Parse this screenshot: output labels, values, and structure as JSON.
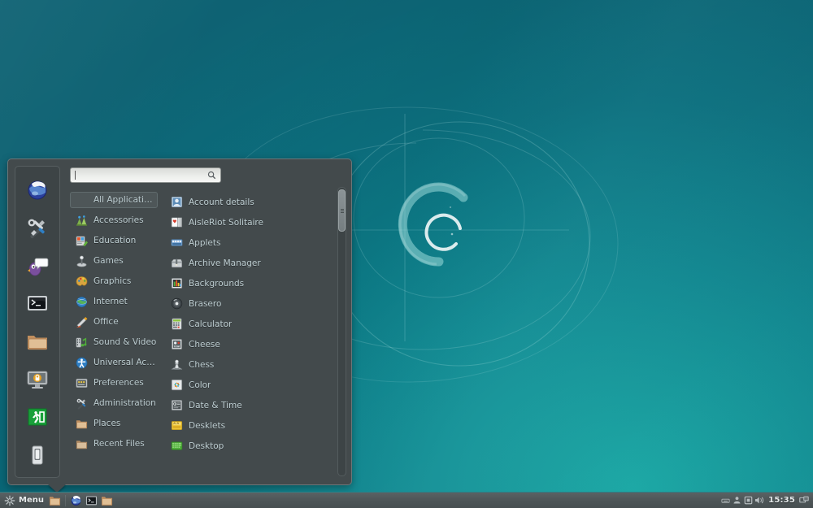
{
  "desktop": {
    "wallpaper_name": "debian-swirl-wallpaper",
    "bg_color_dark": "#095f70",
    "bg_color_light": "#16a7a4"
  },
  "menu": {
    "search": {
      "value": "",
      "placeholder": "",
      "icon": "search-icon"
    },
    "favorites": [
      {
        "name": "web-browser-icon",
        "label": "Web Browser"
      },
      {
        "name": "system-settings-icon",
        "label": "System Settings"
      },
      {
        "name": "chat-pidgin-icon",
        "label": "Pidgin Internet Messenger"
      },
      {
        "name": "terminal-icon",
        "label": "Terminal"
      },
      {
        "name": "file-manager-icon",
        "label": "Files"
      },
      {
        "name": "lock-screen-icon",
        "label": "Lock Screen"
      },
      {
        "name": "logout-icon",
        "label": "Log Out"
      },
      {
        "name": "shutdown-icon",
        "label": "Quit"
      }
    ],
    "categories": [
      {
        "label": "All Applications",
        "icon": "all-applications-icon",
        "selected": true
      },
      {
        "label": "Accessories",
        "icon": "accessories-icon",
        "selected": false
      },
      {
        "label": "Education",
        "icon": "education-icon",
        "selected": false
      },
      {
        "label": "Games",
        "icon": "games-icon",
        "selected": false
      },
      {
        "label": "Graphics",
        "icon": "graphics-icon",
        "selected": false
      },
      {
        "label": "Internet",
        "icon": "internet-icon",
        "selected": false
      },
      {
        "label": "Office",
        "icon": "office-icon",
        "selected": false
      },
      {
        "label": "Sound & Video",
        "icon": "sound-video-icon",
        "selected": false
      },
      {
        "label": "Universal Access",
        "icon": "universal-access-icon",
        "selected": false
      },
      {
        "label": "Preferences",
        "icon": "preferences-icon",
        "selected": false
      },
      {
        "label": "Administration",
        "icon": "administration-icon",
        "selected": false
      },
      {
        "label": "Places",
        "icon": "places-folder-icon",
        "selected": false
      },
      {
        "label": "Recent Files",
        "icon": "recent-files-folder-icon",
        "selected": false
      }
    ],
    "applications": [
      {
        "label": "Account details",
        "icon": "account-details-icon"
      },
      {
        "label": "AisleRiot Solitaire",
        "icon": "aisleriot-solitaire-icon"
      },
      {
        "label": "Applets",
        "icon": "applets-icon"
      },
      {
        "label": "Archive Manager",
        "icon": "archive-manager-icon"
      },
      {
        "label": "Backgrounds",
        "icon": "backgrounds-icon"
      },
      {
        "label": "Brasero",
        "icon": "brasero-icon"
      },
      {
        "label": "Calculator",
        "icon": "calculator-icon"
      },
      {
        "label": "Cheese",
        "icon": "cheese-icon"
      },
      {
        "label": "Chess",
        "icon": "chess-icon"
      },
      {
        "label": "Color",
        "icon": "color-icon"
      },
      {
        "label": "Date & Time",
        "icon": "date-time-icon"
      },
      {
        "label": "Desklets",
        "icon": "desklets-icon"
      },
      {
        "label": "Desktop",
        "icon": "desktop-icon"
      }
    ],
    "scrollbar": {
      "name": "application-list-scrollbar"
    }
  },
  "taskbar": {
    "menu_button": {
      "label": "Menu",
      "icon": "cinnamon-menu-icon"
    },
    "launchers": [
      {
        "name": "launcher-files-icon",
        "label": "Files"
      },
      {
        "name": "launcher-browser-icon",
        "label": "Web Browser"
      },
      {
        "name": "launcher-terminal-icon",
        "label": "Terminal"
      },
      {
        "name": "launcher-folder-icon",
        "label": "Home Folder"
      }
    ],
    "tray": [
      {
        "name": "keyboard-layout-icon",
        "label": "Keyboard layout"
      },
      {
        "name": "user-account-icon",
        "label": "User account"
      },
      {
        "name": "removable-drive-icon",
        "label": "Removable drives"
      },
      {
        "name": "volume-icon",
        "label": "Volume"
      }
    ],
    "clock": "15:35",
    "workspace_switcher": {
      "name": "workspace-switcher-icon",
      "label": "Workspace"
    }
  }
}
